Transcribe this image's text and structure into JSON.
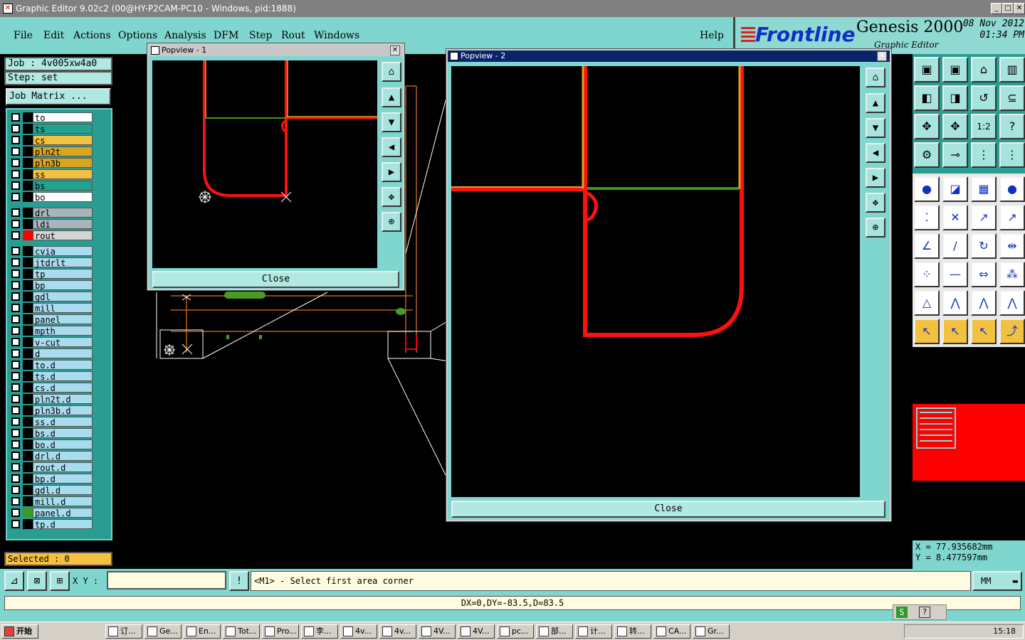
{
  "window": {
    "title": "Graphic Editor 9.02c2 (00@HY-P2CAM-PC10 - Windows, pid:1888)"
  },
  "menu": [
    "File",
    "Edit",
    "Actions",
    "Options",
    "Analysis",
    "DFM",
    "Step",
    "Rout",
    "Windows"
  ],
  "help_label": "Help",
  "brand": {
    "logo": "Frontline",
    "product": "Genesis 2000",
    "subtitle": "Graphic Editor",
    "date": "08 Nov 2012",
    "time": "01:34 PM"
  },
  "job": {
    "label": "Job : 4v005xw4a0",
    "step": "Step: set",
    "matrix_button": "Job Matrix ..."
  },
  "layers": [
    {
      "name": "to",
      "color": "#ffffff"
    },
    {
      "name": "ts",
      "color": "#23a38e"
    },
    {
      "name": "cs",
      "color": "#f3c140"
    },
    {
      "name": "pln2t",
      "color": "#d8a520"
    },
    {
      "name": "pln3b",
      "color": "#d8a520"
    },
    {
      "name": "ss",
      "color": "#f3c140"
    },
    {
      "name": "bs",
      "color": "#23a38e"
    },
    {
      "name": "bo",
      "color": "#ffffff"
    },
    {
      "name": "drl",
      "color": "#a9b5bb"
    },
    {
      "name": "ldi",
      "color": "#a9b5bb"
    },
    {
      "name": "rout",
      "color": "#d4d4d4",
      "swatch": "#ff0000"
    },
    {
      "name": "cvia",
      "color": "#aadcf0"
    },
    {
      "name": "jtdrlt",
      "color": "#aadcf0"
    },
    {
      "name": "tp",
      "color": "#aadcf0"
    },
    {
      "name": "bp",
      "color": "#aadcf0"
    },
    {
      "name": "gdl",
      "color": "#aadcf0"
    },
    {
      "name": "mill",
      "color": "#aadcf0"
    },
    {
      "name": "panel",
      "color": "#aadcf0"
    },
    {
      "name": "mpth",
      "color": "#aadcf0"
    },
    {
      "name": "v-cut",
      "color": "#aadcf0"
    },
    {
      "name": "d",
      "color": "#aadcf0"
    },
    {
      "name": "to.d",
      "color": "#aadcf0"
    },
    {
      "name": "ts.d",
      "color": "#aadcf0"
    },
    {
      "name": "cs.d",
      "color": "#aadcf0"
    },
    {
      "name": "pln2t.d",
      "color": "#aadcf0"
    },
    {
      "name": "pln3b.d",
      "color": "#aadcf0"
    },
    {
      "name": "ss.d",
      "color": "#aadcf0"
    },
    {
      "name": "bs.d",
      "color": "#aadcf0"
    },
    {
      "name": "bo.d",
      "color": "#aadcf0"
    },
    {
      "name": "drl.d",
      "color": "#aadcf0"
    },
    {
      "name": "rout.d",
      "color": "#aadcf0"
    },
    {
      "name": "bp.d",
      "color": "#aadcf0"
    },
    {
      "name": "gdl.d",
      "color": "#aadcf0"
    },
    {
      "name": "mill.d",
      "color": "#aadcf0"
    },
    {
      "name": "panel.d",
      "color": "#aadcf0",
      "swatch": "#3a9a2a"
    },
    {
      "name": "tp.d",
      "color": "#aadcf0"
    }
  ],
  "selected": "Selected : 0",
  "popview1": {
    "title": "Popview - 1",
    "close": "Close"
  },
  "popview2": {
    "title": "Popview - 2",
    "close": "Close"
  },
  "coords": {
    "x": "X = 77.935682mm",
    "y": "Y = 8.477597mm"
  },
  "command": {
    "xy_label": "X Y :",
    "prompt": "<M1> - Select first area corner",
    "units": "MM"
  },
  "status": "DX=0,DY=-83.5,D=83.5",
  "taskbar": {
    "start": "开始",
    "items": [
      "订...",
      "Ge...",
      "En...",
      "Tot...",
      "Pro...",
      "李...",
      "4v...",
      "4v...",
      "4V...",
      "4V...",
      "pc...",
      "部...",
      "计...",
      "转...",
      "CA...",
      "Gr..."
    ],
    "clock": "15:18"
  }
}
